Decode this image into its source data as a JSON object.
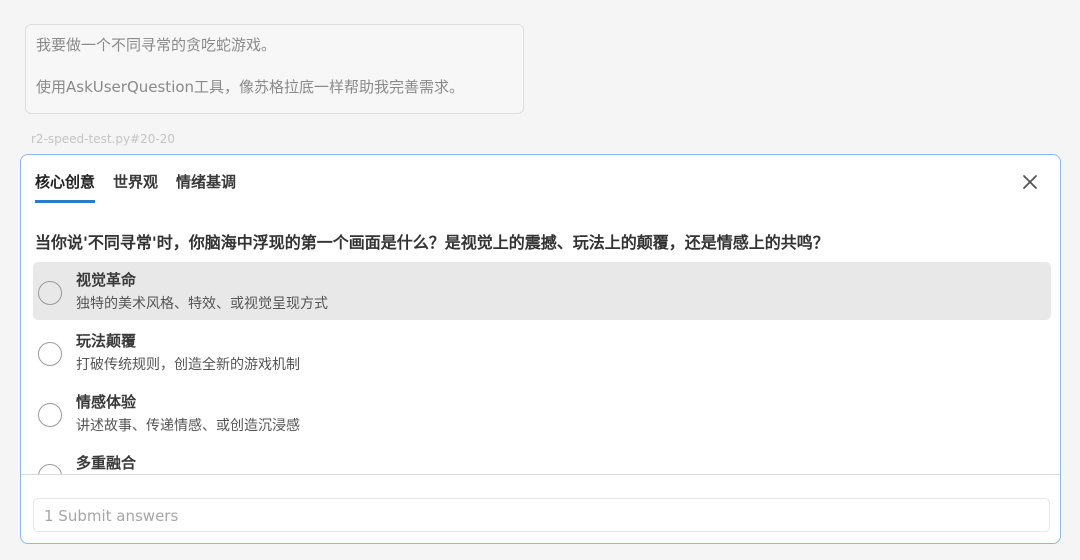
{
  "user_message": {
    "line1": "我要做一个不同寻常的贪吃蛇游戏。",
    "line2": "使用AskUserQuestion工具，像苏格拉底一样帮助我完善需求。"
  },
  "file_ref": "r2-speed-test.py#20-20",
  "tabs": [
    {
      "label": "核心创意",
      "active": true
    },
    {
      "label": "世界观",
      "active": false
    },
    {
      "label": "情绪基调",
      "active": false
    }
  ],
  "close_icon": "close-icon",
  "question": "当你说'不同寻常'时，你脑海中浮现的第一个画面是什么？是视觉上的震撼、玩法上的颠覆，还是情感上的共鸣？",
  "options": [
    {
      "title": "视觉革命",
      "desc": "独特的美术风格、特效、或视觉呈现方式"
    },
    {
      "title": "玩法颠覆",
      "desc": "打破传统规则，创造全新的游戏机制"
    },
    {
      "title": "情感体验",
      "desc": "讲述故事、传递情感、或创造沉浸感"
    },
    {
      "title": "多重融合",
      "desc": ""
    }
  ],
  "submit_label": "1  Submit answers",
  "colors": {
    "accent": "#2f7ac8",
    "panel_border": "#8fb8e8",
    "hover_bg": "#e8e8e8"
  }
}
